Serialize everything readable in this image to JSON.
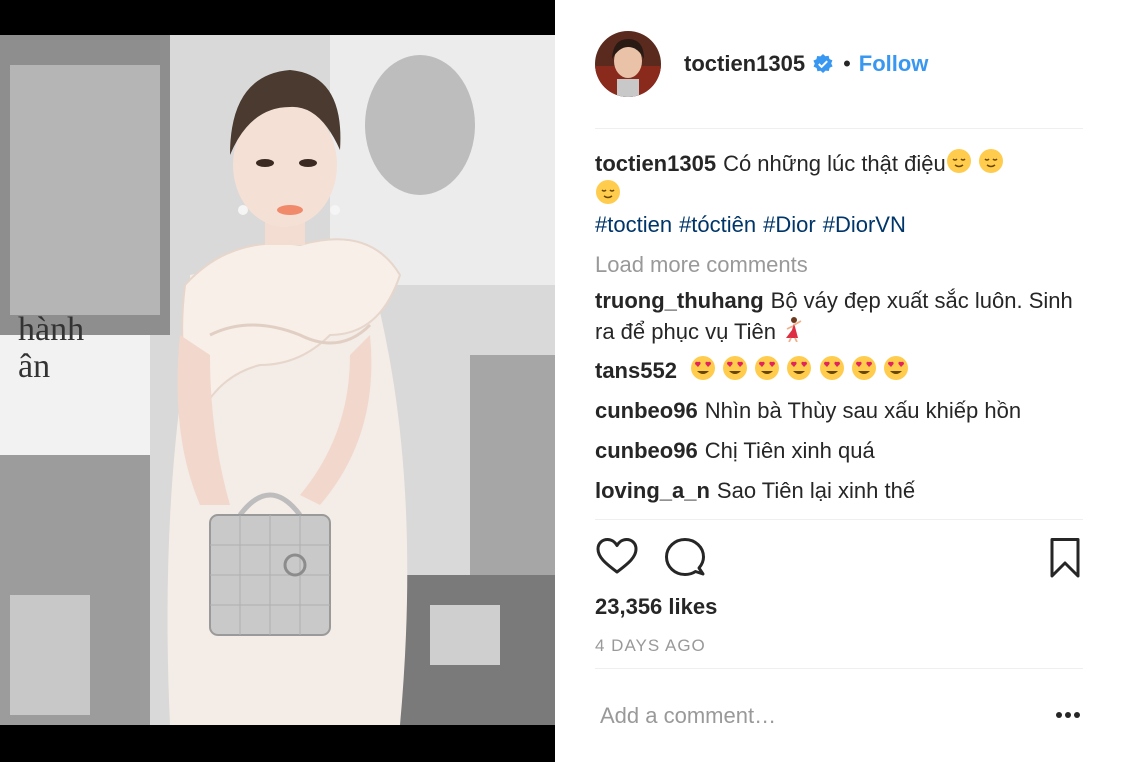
{
  "post": {
    "username": "toctien1305",
    "follow_label": "Follow",
    "separator": "•",
    "caption": {
      "user": "toctien1305",
      "text": "Có những lúc thật điệu",
      "hashtags": [
        "#toctien",
        "#tóctiên",
        "#Dior",
        "#DiorVN"
      ]
    },
    "load_more_label": "Load more comments",
    "comments": [
      {
        "user": "truong_thuhang",
        "text": "Bộ váy đẹp xuất sắc luôn. Sinh ra để phục vụ Tiên"
      },
      {
        "user": "tans552",
        "text": ""
      },
      {
        "user": "cunbeo96",
        "text": "Nhìn bà Thùy sau xấu khiếp hồn"
      },
      {
        "user": "cunbeo96",
        "text": "Chị Tiên xinh quá"
      },
      {
        "user": "loving_a_n",
        "text": "Sao Tiên lại xinh thế"
      }
    ],
    "likes_label": "23,356 likes",
    "time_ago": "4 DAYS AGO",
    "add_comment_placeholder": "Add a comment…"
  },
  "icons": {
    "verified": "verified-badge-icon",
    "like": "heart-icon",
    "comment": "speech-bubble-icon",
    "save": "bookmark-icon",
    "more": "ellipsis-icon",
    "relieved_emoji": "relieved-face-emoji",
    "heart_eyes_emoji": "heart-eyes-emoji",
    "dancer_emoji": "dancer-emoji"
  },
  "colors": {
    "accent": "#3897f0",
    "hashtag": "#003569",
    "muted": "#999999",
    "text": "#262626"
  }
}
